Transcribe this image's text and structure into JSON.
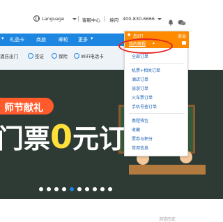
{
  "topbar": {
    "language": "Language",
    "service": "客服中心",
    "region": "境内",
    "phone": "400-830-6666"
  },
  "nav": {
    "items": [
      "礼品卡",
      "商旅",
      "邮轮",
      "更多"
    ]
  },
  "subnav": {
    "items": [
      "酒店出门",
      "签证",
      "保险",
      "WiFi电话卡"
    ]
  },
  "banner": {
    "pill_text": "师节献礼",
    "headline_pre": "门票",
    "headline_zero": "0",
    "headline_post": "元订",
    "slide_count": 10,
    "active_slide": 5
  },
  "dropdown": {
    "greeting": "您好！",
    "logout": "退出",
    "my_itinerary": "我的携程",
    "links_group1": [
      "全部订单"
    ],
    "links_group2": [
      "机票+相关订单",
      "酒店订单",
      "旅游订单",
      "火车票订单",
      "手机号查订单"
    ],
    "links_group3": [
      "携程钱包",
      "收藏",
      "票券与积分",
      "常用信息"
    ]
  },
  "footer": {
    "history": "浏览历史"
  },
  "colors": {
    "brand_blue": "#1d86e0",
    "orange": "#ff8a00",
    "red_highlight": "#e52222"
  }
}
